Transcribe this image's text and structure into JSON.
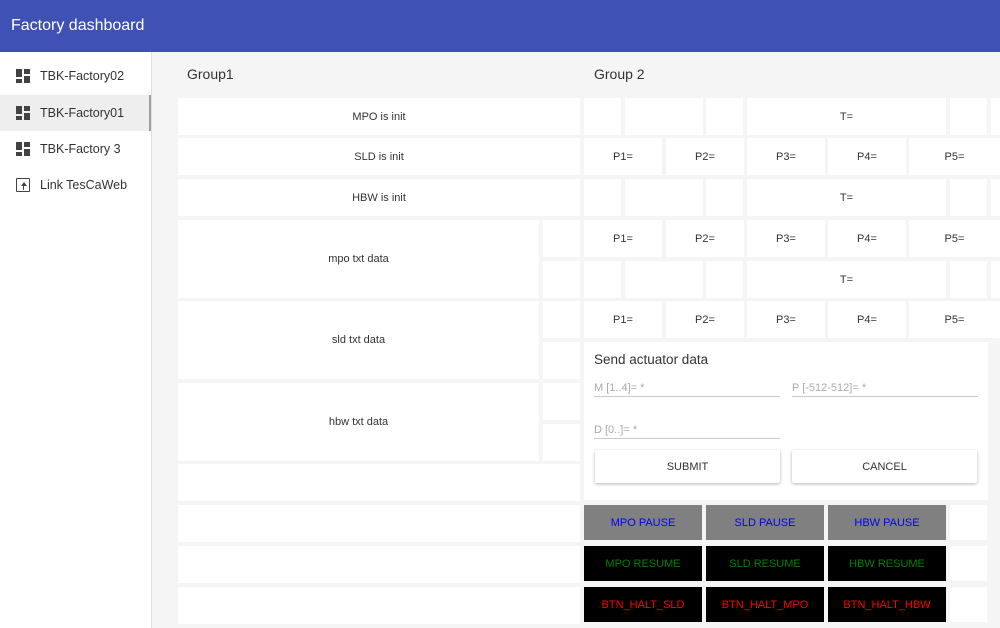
{
  "app": {
    "title": "Factory dashboard"
  },
  "sidebar": {
    "items": [
      {
        "label": "TBK-Factory02",
        "icon": "dashboard-icon"
      },
      {
        "label": "TBK-Factory01",
        "icon": "dashboard-icon",
        "active": true
      },
      {
        "label": "TBK-Factory 3",
        "icon": "dashboard-icon"
      },
      {
        "label": "Link TesCaWeb",
        "icon": "open-link-icon"
      }
    ]
  },
  "group1": {
    "title": "Group1",
    "tiles": [
      "MPO is init",
      "SLD is init",
      "HBW is init",
      "mpo txt data",
      "sld txt data",
      "hbw txt data"
    ]
  },
  "group2": {
    "title": "Group 2",
    "t_label": "T=",
    "p_labels": [
      "P1=",
      "P2=",
      "P3=",
      "P4=",
      "P5="
    ]
  },
  "actuator_form": {
    "title": "Send actuator data",
    "m_placeholder": "M [1..4]= *",
    "p_placeholder": "P [-512-512]= *",
    "d_placeholder": "D [0..]= *",
    "submit": "SUBMIT",
    "cancel": "CANCEL"
  },
  "controls": {
    "pause": [
      "MPO PAUSE",
      "SLD PAUSE",
      "HBW PAUSE"
    ],
    "resume": [
      "MPO RESUME",
      "SLD RESUME",
      "HBW RESUME"
    ],
    "halt": [
      "BTN_HALT_SLD",
      "BTN_HALT_MPO",
      "BTN_HALT_HBW"
    ]
  },
  "colors": {
    "app_bar": "#3f51b5",
    "pause_bg": "#808080",
    "pause_text": "#0000ff",
    "resume_text": "#008000",
    "halt_text": "#ff0000"
  }
}
